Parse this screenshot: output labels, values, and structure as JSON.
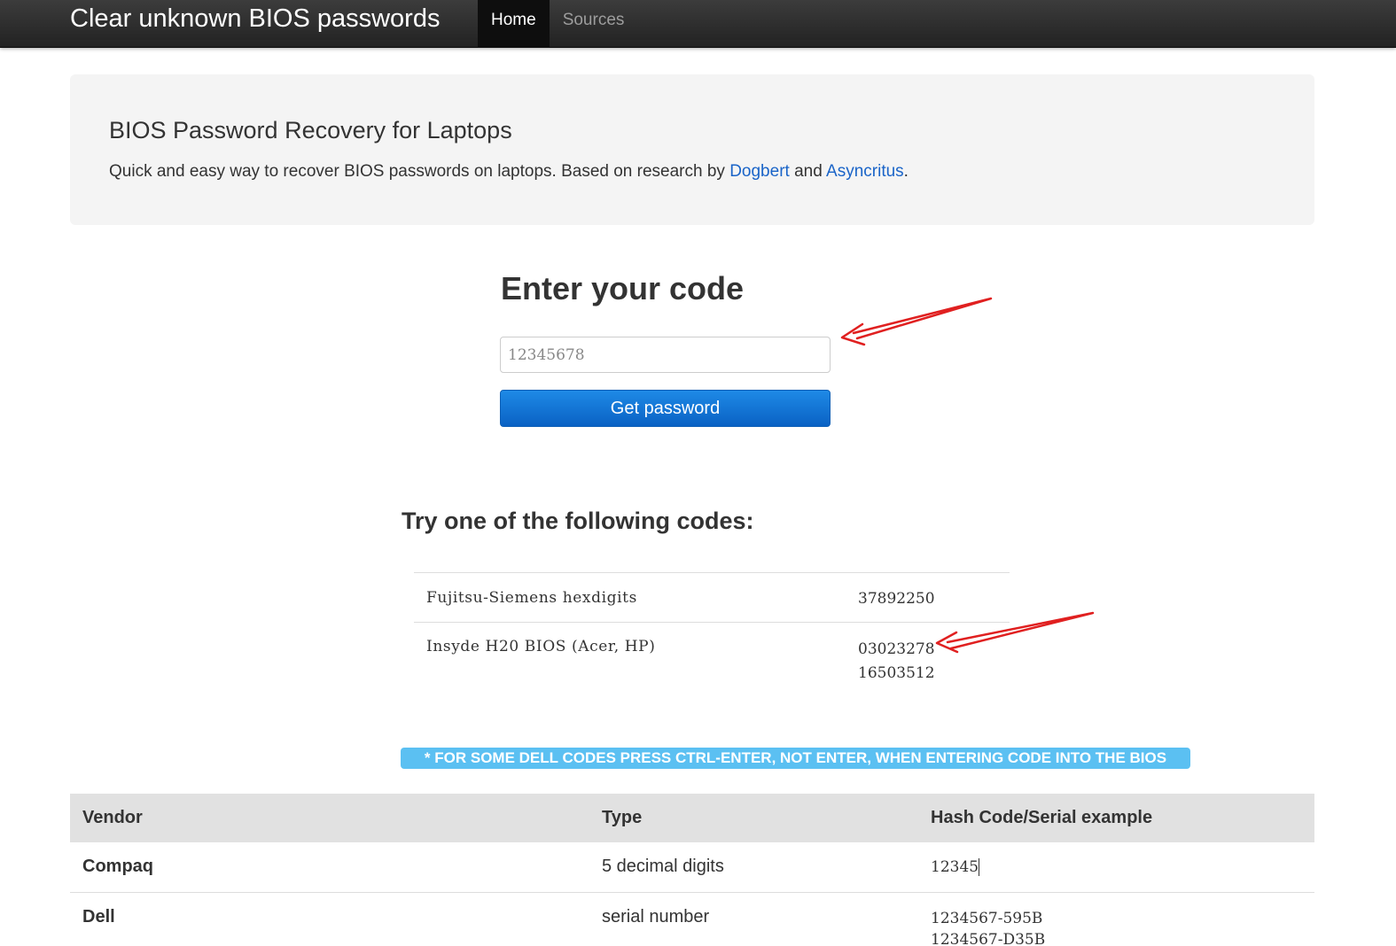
{
  "navbar": {
    "brand": "Clear unknown BIOS passwords",
    "items": [
      {
        "label": "Home",
        "active": true
      },
      {
        "label": "Sources",
        "active": false
      }
    ]
  },
  "jumbotron": {
    "title": "BIOS Password Recovery for Laptops",
    "desc_prefix": "Quick and easy way to recover BIOS passwords on laptops. Based on research by ",
    "link1": "Dogbert",
    "desc_mid": " and ",
    "link2": "Asyncritus",
    "desc_suffix": "."
  },
  "form": {
    "title": "Enter your code",
    "input_value": "12345678",
    "button_label": "Get password"
  },
  "codes": {
    "title": "Try one of the following codes:",
    "rows": [
      {
        "vendor": "Fujitsu-Siemens hexdigits",
        "codes": [
          "37892250"
        ]
      },
      {
        "vendor": "Insyde H20 BIOS (Acer, HP)",
        "codes": [
          "03023278",
          "16503512"
        ]
      }
    ]
  },
  "dell_note": "* FOR SOME DELL CODES PRESS CTRL-ENTER, NOT ENTER, WHEN ENTERING CODE INTO THE BIOS",
  "vendor_table": {
    "headers": [
      "Vendor",
      "Type",
      "Hash Code/Serial example"
    ],
    "rows": [
      {
        "vendor": "Compaq",
        "type": "5 decimal digits",
        "examples": [
          "12345"
        ]
      },
      {
        "vendor": "Dell",
        "type": "serial number",
        "examples": [
          "1234567-595B",
          "1234567-D35B"
        ]
      }
    ]
  },
  "colors": {
    "navbar": "#222222",
    "link": "#1a64c8",
    "button": "#0a62c4",
    "note_bg": "#5bc0f2",
    "annotation_arrow": "#e02020"
  }
}
